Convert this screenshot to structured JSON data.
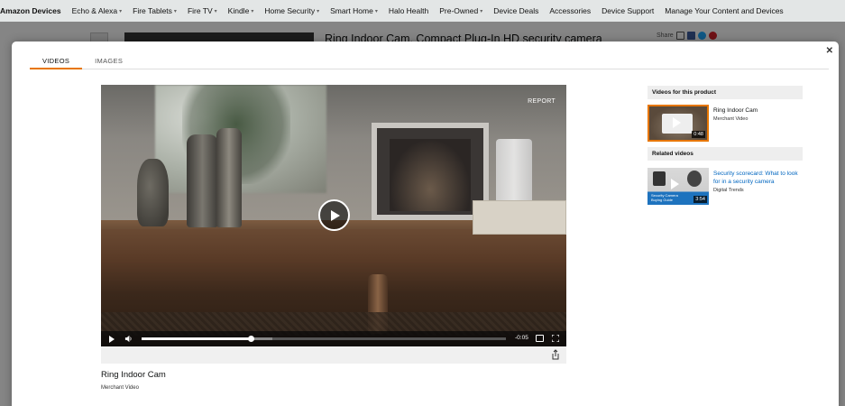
{
  "topnav": {
    "brand": "Amazon Devices",
    "items": [
      {
        "label": "Echo & Alexa",
        "dropdown": true
      },
      {
        "label": "Fire Tablets",
        "dropdown": true
      },
      {
        "label": "Fire TV",
        "dropdown": true
      },
      {
        "label": "Kindle",
        "dropdown": true
      },
      {
        "label": "Home Security",
        "dropdown": true
      },
      {
        "label": "Smart Home",
        "dropdown": true
      },
      {
        "label": "Halo Health",
        "dropdown": false
      },
      {
        "label": "Pre-Owned",
        "dropdown": true
      },
      {
        "label": "Device Deals",
        "dropdown": false
      },
      {
        "label": "Accessories",
        "dropdown": false
      },
      {
        "label": "Device Support",
        "dropdown": false
      },
      {
        "label": "Manage Your Content and Devices",
        "dropdown": false
      }
    ]
  },
  "background": {
    "product_title": "Ring Indoor Cam, Compact Plug-In HD security camera",
    "share_label": "Share"
  },
  "modal": {
    "tabs": [
      "VIDEOS",
      "IMAGES"
    ],
    "active_tab": 0,
    "player": {
      "report_label": "REPORT",
      "time": "-0:05",
      "progress": 0.3,
      "buffered": 0.36
    },
    "video_title": "Ring Indoor Cam",
    "video_source": "Merchant Video",
    "product_videos_header": "Videos for this product",
    "product_videos": [
      {
        "title": "Ring Indoor Cam",
        "source": "Merchant Video",
        "duration": "0:48",
        "selected": true
      }
    ],
    "related_videos_header": "Related videos",
    "related_videos": [
      {
        "title": "Security scorecard: What to look for in a security camera",
        "source": "Digital Trends",
        "duration": "3:54",
        "thumb_caption": "Security Camera Buying Guide"
      }
    ]
  },
  "colors": {
    "accent": "#e77600",
    "link": "#0066c0"
  }
}
